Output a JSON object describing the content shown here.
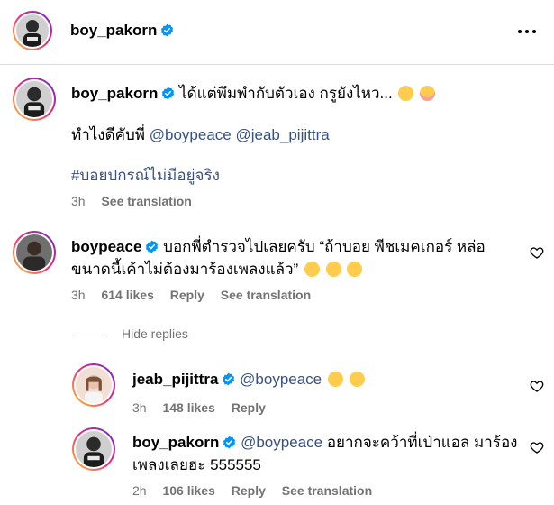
{
  "header": {
    "username": "boy_pakorn"
  },
  "caption": {
    "username": "boy_pakorn",
    "text": "ได้แต่พึมพำกับตัวเอง กรูยังไหว...",
    "line2_prefix": "ทำไงดีคับพี่",
    "mention1": "@boypeace",
    "mention2": "@jeab_pijittra",
    "hashtag": "#บอยปกรณ์ไม่มีอยู่จริง",
    "time": "3h",
    "see_translation": "See translation"
  },
  "comments": [
    {
      "username": "boypeace",
      "line1": "บอกพี่ตำรวจไปเลยครับ “ถ้าบอย พีชเมคเกอร์ หล่อ",
      "line2": "ขนาดนี้เค้าไม่ต้องมาร้องเพลงแล้ว”",
      "time": "3h",
      "likes": "614 likes",
      "reply": "Reply",
      "see_translation": "See translation"
    }
  ],
  "hide_replies": "Hide replies",
  "replies": [
    {
      "username": "jeab_pijittra",
      "mention": "@boypeace",
      "text": "",
      "time": "3h",
      "likes": "148 likes",
      "reply": "Reply"
    },
    {
      "username": "boy_pakorn",
      "mention": "@boypeace",
      "line1": "อยากจะคว้าที่เป่าแอล มาร้อง",
      "line2": "เพลงเลยฮะ 555555",
      "time": "2h",
      "likes": "106 likes",
      "reply": "Reply",
      "see_translation": "See translation"
    }
  ],
  "colors": {
    "verified": "#0095f6",
    "mention": "#385185",
    "meta": "#737373"
  },
  "icons": [
    "verified-badge-icon",
    "more-options-icon",
    "heart-icon",
    "grinning-sweat-emoji",
    "laughing-emoji",
    "pensive-emoji",
    "teary-emoji"
  ]
}
